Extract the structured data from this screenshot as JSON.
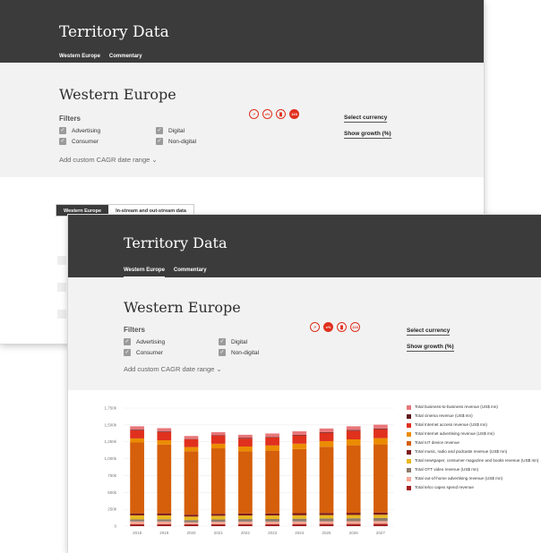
{
  "back": {
    "title": "Territory Data",
    "tabs": [
      "Western Europe",
      "Commentary"
    ],
    "region": "Western Europe",
    "filters_label": "Filters",
    "checkboxes": [
      "Advertising",
      "Digital",
      "Consumer",
      "Non-digital"
    ],
    "cagr": "Add custom CAGR date range",
    "icons": [
      "line-chart-icon",
      "growth-icon",
      "bar-chart-icon",
      "table-icon"
    ],
    "icon_glyphs": [
      "↗",
      "x%",
      "▐▌",
      "123"
    ],
    "select_currency": "Select currency",
    "show_growth": "Show growth (%)",
    "subtabs": [
      "Western Europe",
      "In-stream and out-stream data"
    ]
  },
  "front": {
    "title": "Territory Data",
    "tabs": [
      "Western Europe",
      "Commentary"
    ],
    "region": "Western Europe",
    "filters_label": "Filters",
    "checkboxes": [
      "Advertising",
      "Digital",
      "Consumer",
      "Non-digital"
    ],
    "cagr": "Add custom CAGR date range",
    "icon_glyphs": [
      "↗",
      "x%",
      "▐▌",
      "123"
    ],
    "select_currency": "Select currency",
    "show_growth": "Show growth (%)"
  },
  "chart_data": {
    "type": "bar",
    "stacked": true,
    "categories": [
      "2018",
      "2019",
      "2020",
      "2021",
      "2022",
      "2023",
      "2024",
      "2025",
      "2026",
      "2027"
    ],
    "yticks": [
      "1,750k",
      "1,500k",
      "1,250k",
      "1,000k",
      "750k",
      "500k",
      "250k",
      "0"
    ],
    "ylim": [
      0,
      1750000
    ],
    "series": [
      {
        "name": "Total telco capex spend revenue",
        "color": "#a32020",
        "values": [
          30000,
          30000,
          28000,
          29000,
          30000,
          30000,
          31000,
          32000,
          32000,
          33000
        ]
      },
      {
        "name": "Total out-of-home advertising revenue (US$ mn)",
        "color": "#f7a896",
        "values": [
          40000,
          40000,
          30000,
          36000,
          38000,
          38000,
          39000,
          40000,
          41000,
          42000
        ]
      },
      {
        "name": "Total OTT video revenue (US$ mn)",
        "color": "#8c7b6b",
        "values": [
          30000,
          32000,
          32000,
          35000,
          37000,
          38000,
          40000,
          42000,
          44000,
          46000
        ]
      },
      {
        "name": "Total newspaper, consumer magazine and books revenue (US$ mn)",
        "color": "#e8b821",
        "values": [
          60000,
          58000,
          52000,
          54000,
          53000,
          52000,
          51000,
          50000,
          49000,
          48000
        ]
      },
      {
        "name": "Total music, radio and podcasts revenue (US$ mn)",
        "color": "#7d1a1a",
        "values": [
          30000,
          30000,
          28000,
          29000,
          30000,
          31000,
          31000,
          32000,
          32000,
          33000
        ]
      },
      {
        "name": "Total IoT device revenue",
        "color": "#d55f0a",
        "values": [
          1050000,
          1020000,
          940000,
          970000,
          920000,
          930000,
          950000,
          980000,
          1000000,
          1010000
        ]
      },
      {
        "name": "Total Internet advertising revenue (US$ mn)",
        "color": "#eb8c00",
        "values": [
          60000,
          62000,
          62000,
          68000,
          72000,
          76000,
          80000,
          84000,
          88000,
          92000
        ]
      },
      {
        "name": "Total Internet access revenue (US$ mn)",
        "color": "#e0301e",
        "values": [
          120000,
          120000,
          115000,
          118000,
          118000,
          120000,
          122000,
          124000,
          128000,
          132000
        ]
      },
      {
        "name": "Total cinema revenue (US$ mn)",
        "color": "#5c1a1a",
        "values": [
          10000,
          10000,
          4000,
          6000,
          8000,
          8000,
          9000,
          9000,
          10000,
          10000
        ]
      },
      {
        "name": "Total business-to-business revenue (US$ mn)",
        "color": "#e8777a",
        "values": [
          50000,
          50000,
          45000,
          48000,
          48000,
          50000,
          52000,
          54000,
          56000,
          58000
        ]
      }
    ],
    "legend_order": [
      "Total business-to-business revenue (US$ mn)",
      "Total cinema revenue (US$ mn)",
      "Total Internet access revenue (US$ mn)",
      "Total Internet advertising revenue (US$ mn)",
      "Total IoT device revenue",
      "Total music, radio and podcasts revenue (US$ mn)",
      "Total newspaper, consumer magazine and books revenue (US$ mn)",
      "Total OTT video revenue (US$ mn)",
      "Total out-of-home advertising revenue (US$ mn)",
      "Total telco capex spend revenue"
    ],
    "legend": "right"
  }
}
